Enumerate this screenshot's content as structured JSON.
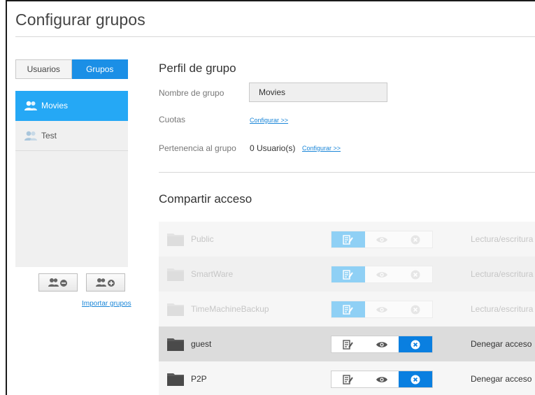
{
  "header": {
    "title": "Configurar grupos"
  },
  "tabs": [
    {
      "label": "Usuarios",
      "active": false
    },
    {
      "label": "Grupos",
      "active": true
    }
  ],
  "groups": [
    {
      "name": "Movies",
      "selected": true
    },
    {
      "name": "Test",
      "selected": false
    }
  ],
  "left_actions": {
    "remove_icon": "group-remove-icon",
    "add_icon": "group-add-icon",
    "import_label": "Importar grupos"
  },
  "profile": {
    "title": "Perfil de grupo",
    "name_label": "Nombre de grupo",
    "name_value": "Movies",
    "quota_label": "Cuotas",
    "quota_link": "Configurar >>",
    "membership_label": "Pertenencia al grupo",
    "membership_value": "0 Usuario(s)",
    "membership_link": "Configurar >>"
  },
  "share": {
    "title": "Compartir acceso",
    "rows": [
      {
        "name": "Public",
        "access": "Lectura/escritura",
        "enabled": false
      },
      {
        "name": "SmartWare",
        "access": "Lectura/escritura",
        "enabled": false
      },
      {
        "name": "TimeMachineBackup",
        "access": "Lectura/escritura",
        "enabled": false
      },
      {
        "name": "guest",
        "access": "Denegar acceso",
        "enabled": true
      },
      {
        "name": "P2P",
        "access": "Denegar acceso",
        "enabled": true
      }
    ]
  },
  "colors": {
    "accent": "#1b8fe6",
    "selected_group": "#25a8f5",
    "link": "#1a86d8",
    "readwrite_active": "#8fd0f5",
    "deny_active": "#0a7fe0"
  }
}
